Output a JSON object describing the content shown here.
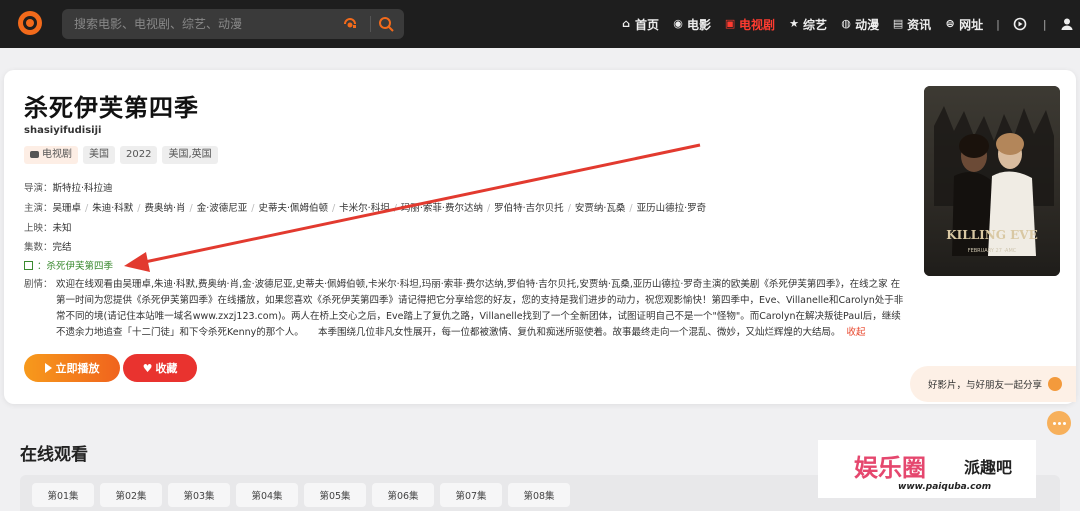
{
  "header": {
    "search_placeholder": "搜索电影、电视剧、综艺、动漫",
    "nav": [
      {
        "label": "首页",
        "icon": "home-icon",
        "glyph": "⌂",
        "active": false
      },
      {
        "label": "电影",
        "icon": "film-reel-icon",
        "glyph": "◉",
        "active": false
      },
      {
        "label": "电视剧",
        "icon": "tv-icon",
        "glyph": "▣",
        "active": true
      },
      {
        "label": "综艺",
        "icon": "star-icon",
        "glyph": "★",
        "active": false
      },
      {
        "label": "动漫",
        "icon": "bulb-icon",
        "glyph": "◍",
        "active": false
      },
      {
        "label": "资讯",
        "icon": "news-icon",
        "glyph": "▤",
        "active": false
      },
      {
        "label": "网址",
        "icon": "globe-icon",
        "glyph": "⊜",
        "active": false
      }
    ],
    "nav_separator": "|"
  },
  "detail": {
    "title": "杀死伊芙第四季",
    "pinyin": "shasiyifudisiji",
    "tags": {
      "type": "电视剧",
      "region": "美国",
      "year": "2022",
      "lang": "美国,英国"
    },
    "director_label": "导演：",
    "director": "斯特拉·科拉迪",
    "cast_label": "主演：",
    "cast": [
      "吴珊卓",
      "朱迪·科默",
      "费奥纳·肖",
      "金·波德尼亚",
      "史蒂夫·佩姆伯顿",
      "卡米尔·科坦",
      "玛丽·索菲·费尔达纳",
      "罗伯特·吉尔贝托",
      "安贾纳·瓦桑",
      "亚历山德拉·罗奇"
    ],
    "release_label": "上映：",
    "release": "未知",
    "episodes_label": "集数：",
    "episodes_status": "完结",
    "link_text": "：杀死伊芙第四季",
    "plot_label": "剧情：",
    "plot": "欢迎在线观看由吴珊卓,朱迪·科默,费奥纳·肖,金·波德尼亚,史蒂夫·佩姆伯顿,卡米尔·科坦,玛丽·索菲·费尔达纳,罗伯特·吉尔贝托,安贾纳·瓦桑,亚历山德拉·罗奇主演的欧美剧《杀死伊芙第四季》，在线之家 在第一时间为您提供《杀死伊芙第四季》在线播放，如果您喜欢《杀死伊芙第四季》请记得把它分享给您的好友，您的支持是我们进步的动力，祝您观影愉快！第四季中，Eve、Villanelle和Carolyn处于非常不同的境(请记住本站唯一域名www.zxzj123.com)。两人在桥上交心之后，Eve踏上了复仇之路，Villanelle找到了一个全新团体，试图证明自己不是一个\"怪物\"。而Carolyn在解决叛徒Paul后，继续不遗余力地追查「十二门徒」和下令杀死Kenny的那个人。　　本季围绕几位非凡女性展开，每一位都被激情、复仇和痴迷所驱使着。故事最终走向一个混乱、微妙，又灿烂辉煌的大结局。",
    "collapse_label": "收起",
    "play_label": "立即播放",
    "fav_label": "收藏",
    "share_text": "好影片，与好朋友一起分享"
  },
  "watch": {
    "section_title": "在线观看",
    "episodes": [
      "第01集",
      "第02集",
      "第03集",
      "第04集",
      "第05集",
      "第06集",
      "第07集",
      "第08集"
    ]
  },
  "watermark": {
    "logo_text": "娱乐圈",
    "brand": "派趣吧",
    "url": "www.paiquba.com"
  },
  "colors": {
    "accent": "#f26a1b",
    "active_nav": "#ff3b30",
    "favorite": "#e9332f",
    "link_green": "#3a8a2f",
    "annotation_arrow": "#e23a2f"
  }
}
